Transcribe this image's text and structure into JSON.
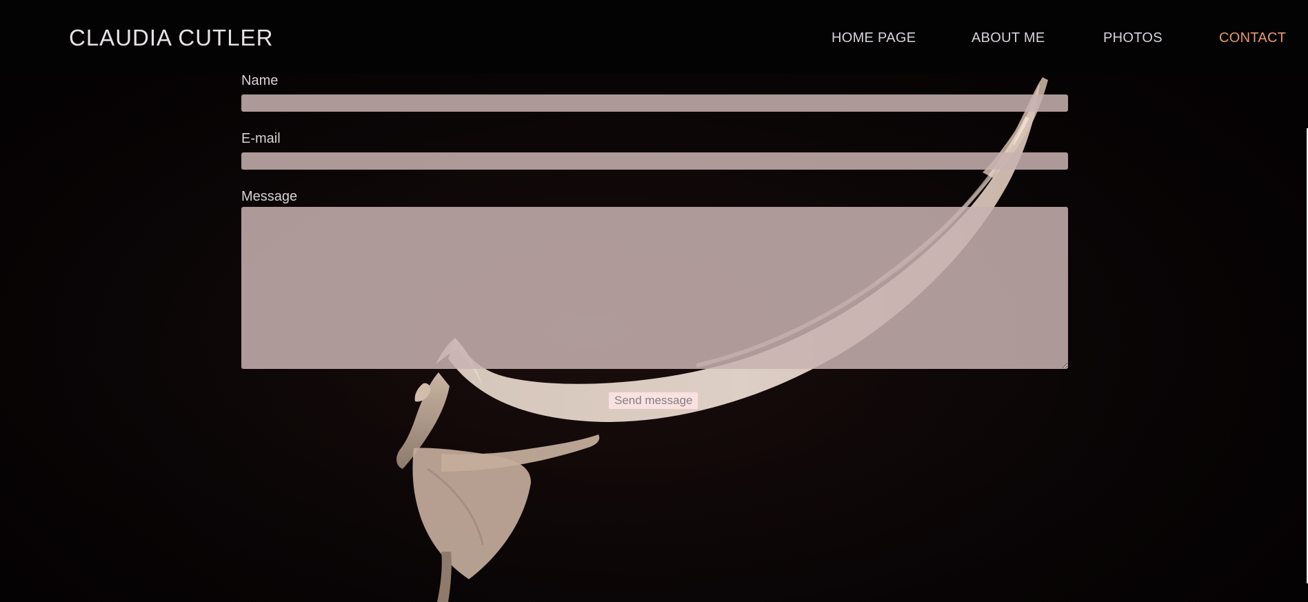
{
  "site": {
    "brand": "CLAUDIA CUTLER"
  },
  "nav": {
    "items": [
      {
        "label": "HOME PAGE"
      },
      {
        "label": "ABOUT ME"
      },
      {
        "label": "PHOTOS"
      },
      {
        "label": "CONTACT",
        "active": true
      }
    ]
  },
  "contact_form": {
    "name_label": "Name",
    "name_value": "",
    "email_label": "E-mail",
    "email_value": "",
    "message_label": "Message",
    "message_value": "",
    "submit_label": "Send message"
  },
  "background": {
    "image": "ballet dancer with flowing silk scarf on black stage"
  },
  "colors": {
    "nav_background": "#040304",
    "nav_text": "#d9d4dc",
    "nav_active": "#e69a6b",
    "field_fill": "#c8b2b1",
    "button_fill": "#f8e4e3",
    "button_border": "#f2c3c4"
  }
}
